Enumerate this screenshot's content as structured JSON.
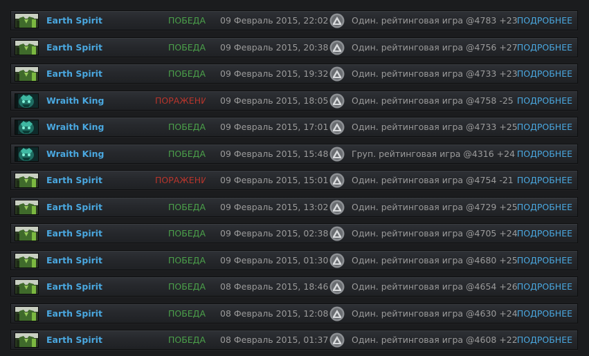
{
  "colors": {
    "hero_name": "#4aa8e0",
    "win": "#4ba14a",
    "loss": "#b8352c",
    "text_gray": "#9b9b9b",
    "details_link": "#4aa8e0"
  },
  "matches": [
    {
      "hero": "Earth Spirit",
      "hero_icon": "earth-spirit-portrait-icon",
      "result": "ПОБЕДА",
      "outcome": "win",
      "date": "09 Февраль 2015, 22:02",
      "mode_icon": "ranked-mode-icon",
      "description": "Один. рейтинговая игра @4783 +23",
      "details": "ПОДРОБНЕЕ"
    },
    {
      "hero": "Earth Spirit",
      "hero_icon": "earth-spirit-portrait-icon",
      "result": "ПОБЕДА",
      "outcome": "win",
      "date": "09 Февраль 2015, 20:38",
      "mode_icon": "ranked-mode-icon",
      "description": "Один. рейтинговая игра @4756 +27",
      "details": "ПОДРОБНЕЕ"
    },
    {
      "hero": "Earth Spirit",
      "hero_icon": "earth-spirit-portrait-icon",
      "result": "ПОБЕДА",
      "outcome": "win",
      "date": "09 Февраль 2015, 19:32",
      "mode_icon": "ranked-mode-icon",
      "description": "Один. рейтинговая игра @4733 +23",
      "details": "ПОДРОБНЕЕ"
    },
    {
      "hero": "Wraith King",
      "hero_icon": "wraith-king-portrait-icon",
      "result": "ПОРАЖЕНИ",
      "outcome": "loss",
      "date": "09 Февраль 2015, 18:05",
      "mode_icon": "ranked-mode-icon",
      "description": "Один. рейтинговая игра @4758 -25",
      "details": "ПОДРОБНЕЕ"
    },
    {
      "hero": "Wraith King",
      "hero_icon": "wraith-king-portrait-icon",
      "result": "ПОБЕДА",
      "outcome": "win",
      "date": "09 Февраль 2015, 17:01",
      "mode_icon": "ranked-mode-icon",
      "description": "Один. рейтинговая игра @4733 +25",
      "details": "ПОДРОБНЕЕ"
    },
    {
      "hero": "Wraith King",
      "hero_icon": "wraith-king-portrait-icon",
      "result": "ПОБЕДА",
      "outcome": "win",
      "date": "09 Февраль 2015, 15:48",
      "mode_icon": "ranked-mode-icon",
      "description": "Груп. рейтинговая игра @4316 +24",
      "details": "ПОДРОБНЕЕ"
    },
    {
      "hero": "Earth Spirit",
      "hero_icon": "earth-spirit-portrait-icon",
      "result": "ПОРАЖЕНИ",
      "outcome": "loss",
      "date": "09 Февраль 2015, 15:01",
      "mode_icon": "ranked-mode-icon",
      "description": "Один. рейтинговая игра @4754 -21",
      "details": "ПОДРОБНЕЕ"
    },
    {
      "hero": "Earth Spirit",
      "hero_icon": "earth-spirit-portrait-icon",
      "result": "ПОБЕДА",
      "outcome": "win",
      "date": "09 Февраль 2015, 13:02",
      "mode_icon": "ranked-mode-icon",
      "description": "Один. рейтинговая игра @4729 +25",
      "details": "ПОДРОБНЕЕ"
    },
    {
      "hero": "Earth Spirit",
      "hero_icon": "earth-spirit-portrait-icon",
      "result": "ПОБЕДА",
      "outcome": "win",
      "date": "09 Февраль 2015, 02:38",
      "mode_icon": "ranked-mode-icon",
      "description": "Один. рейтинговая игра @4705 +24",
      "details": "ПОДРОБНЕЕ"
    },
    {
      "hero": "Earth Spirit",
      "hero_icon": "earth-spirit-portrait-icon",
      "result": "ПОБЕДА",
      "outcome": "win",
      "date": "09 Февраль 2015, 01:30",
      "mode_icon": "ranked-mode-icon",
      "description": "Один. рейтинговая игра @4680 +25",
      "details": "ПОДРОБНЕЕ"
    },
    {
      "hero": "Earth Spirit",
      "hero_icon": "earth-spirit-portrait-icon",
      "result": "ПОБЕДА",
      "outcome": "win",
      "date": "08 Февраль 2015, 18:46",
      "mode_icon": "ranked-mode-icon",
      "description": "Один. рейтинговая игра @4654 +26",
      "details": "ПОДРОБНЕЕ"
    },
    {
      "hero": "Earth Spirit",
      "hero_icon": "earth-spirit-portrait-icon",
      "result": "ПОБЕДА",
      "outcome": "win",
      "date": "08 Февраль 2015, 12:08",
      "mode_icon": "ranked-mode-icon",
      "description": "Один. рейтинговая игра @4630 +24",
      "details": "ПОДРОБНЕЕ"
    },
    {
      "hero": "Earth Spirit",
      "hero_icon": "earth-spirit-portrait-icon",
      "result": "ПОБЕДА",
      "outcome": "win",
      "date": "08 Февраль 2015, 01:37",
      "mode_icon": "ranked-mode-icon",
      "description": "Один. рейтинговая игра @4608 +22",
      "details": "ПОДРОБНЕЕ"
    }
  ]
}
